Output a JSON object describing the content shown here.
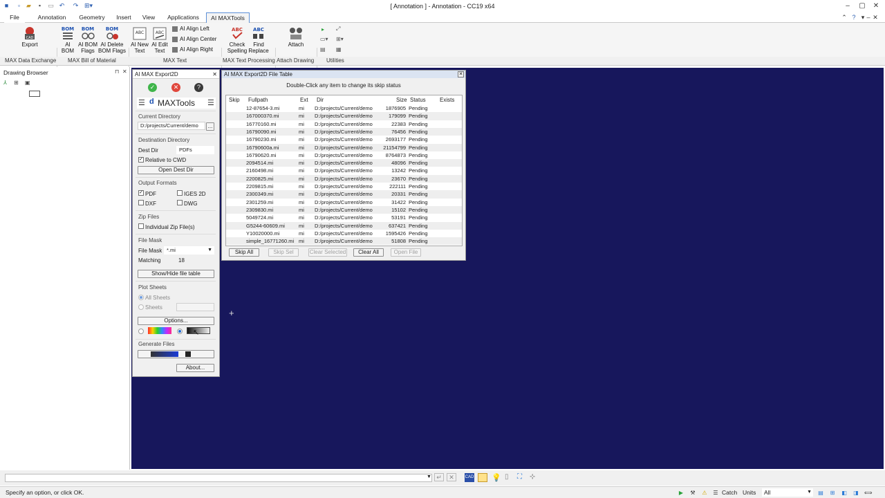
{
  "window": {
    "title": "[ Annotation ] - Annotation - CC19 x64"
  },
  "tabs": [
    "File",
    "Annotation",
    "Geometry",
    "Insert",
    "View",
    "Applications",
    "AI MAXTools"
  ],
  "ribbon": {
    "export": "Export",
    "ai_bom": "AI BOM",
    "ai_bom_line1": "AI",
    "ai_bom_line2": "BOM",
    "ai_bom_flags_line1": "AI BOM",
    "ai_bom_flags_line2": "Flags",
    "ai_delete_line1": "AI Delete",
    "ai_delete_line2": "BOM Flags",
    "ai_new_line1": "AI New",
    "ai_new_line2": "Text",
    "ai_edit_line1": "AI Edit",
    "ai_edit_line2": "Text",
    "align_left": "AI Align Left",
    "align_center": "AI Align Center",
    "align_right": "AI Align Right",
    "check_line1": "Check",
    "check_line2": "Spelling",
    "find_line1": "Find",
    "find_line2": "Replace",
    "attach": "Attach",
    "groups": [
      "MAX Data Exchange",
      "MAX Bill of Material",
      "MAX Text",
      "MAX Text Processing",
      "Attach Drawing",
      "Utilities"
    ]
  },
  "browser": {
    "title": "Drawing Browser"
  },
  "export_panel": {
    "title": "AI MAX Export2D",
    "logo": "MAXTools",
    "current_directory_label": "Current Directory",
    "current_directory_value": "D:/projects/Current/demo",
    "browse": "...",
    "destination_label": "Destination Directory",
    "dest_dir_label": "Dest Dir",
    "dest_dir_value": "PDFs",
    "relative_cwd": "Relative to CWD",
    "open_dest_dir": "Open Dest Dir",
    "output_formats": "Output Formats",
    "pdf": "PDF",
    "iges2d": "IGES 2D",
    "dxf": "DXF",
    "dwg": "DWG",
    "zip_files": "Zip Files",
    "individual_zip": "Individual Zip File(s)",
    "file_mask_section": "File Mask",
    "file_mask_label": "File Mask",
    "file_mask_value": "*.mi",
    "matching_label": "Matching",
    "matching_value": "18",
    "show_hide": "Show/Hide file table",
    "plot_sheets": "Plot Sheets",
    "all_sheets": "All Sheets",
    "sheets": "Sheets",
    "options": "Options...",
    "generate_files": "Generate Files",
    "about": "About..."
  },
  "file_table": {
    "title": "AI MAX Export2D File Table",
    "instruction": "Double-Click any item to change its skip status",
    "columns": [
      "Skip",
      "Fullpath",
      "Ext",
      "Dir",
      "Size",
      "Status",
      "Exists"
    ],
    "rows": [
      {
        "fullpath": "12-87654-3.mi",
        "ext": "mi",
        "dir": "D:/projects/Current/demo",
        "size": "1876905",
        "status": "Pending"
      },
      {
        "fullpath": "167000370.mi",
        "ext": "mi",
        "dir": "D:/projects/Current/demo",
        "size": "179099",
        "status": "Pending"
      },
      {
        "fullpath": "16770160.mi",
        "ext": "mi",
        "dir": "D:/projects/Current/demo",
        "size": "22383",
        "status": "Pending"
      },
      {
        "fullpath": "16790090.mi",
        "ext": "mi",
        "dir": "D:/projects/Current/demo",
        "size": "76456",
        "status": "Pending"
      },
      {
        "fullpath": "16790230.mi",
        "ext": "mi",
        "dir": "D:/projects/Current/demo",
        "size": "2693177",
        "status": "Pending"
      },
      {
        "fullpath": "16790600a.mi",
        "ext": "mi",
        "dir": "D:/projects/Current/demo",
        "size": "21154799",
        "status": "Pending"
      },
      {
        "fullpath": "16790620.mi",
        "ext": "mi",
        "dir": "D:/projects/Current/demo",
        "size": "8764873",
        "status": "Pending"
      },
      {
        "fullpath": "2094514.mi",
        "ext": "mi",
        "dir": "D:/projects/Current/demo",
        "size": "48096",
        "status": "Pending"
      },
      {
        "fullpath": "2160498.mi",
        "ext": "mi",
        "dir": "D:/projects/Current/demo",
        "size": "13242",
        "status": "Pending"
      },
      {
        "fullpath": "2200825.mi",
        "ext": "mi",
        "dir": "D:/projects/Current/demo",
        "size": "23670",
        "status": "Pending"
      },
      {
        "fullpath": "2209815.mi",
        "ext": "mi",
        "dir": "D:/projects/Current/demo",
        "size": "222111",
        "status": "Pending"
      },
      {
        "fullpath": "2300349.mi",
        "ext": "mi",
        "dir": "D:/projects/Current/demo",
        "size": "20331",
        "status": "Pending"
      },
      {
        "fullpath": "2301259.mi",
        "ext": "mi",
        "dir": "D:/projects/Current/demo",
        "size": "31422",
        "status": "Pending"
      },
      {
        "fullpath": "2309830.mi",
        "ext": "mi",
        "dir": "D:/projects/Current/demo",
        "size": "15102",
        "status": "Pending"
      },
      {
        "fullpath": "5049724.mi",
        "ext": "mi",
        "dir": "D:/projects/Current/demo",
        "size": "53191",
        "status": "Pending"
      },
      {
        "fullpath": "G5244-60609.mi",
        "ext": "mi",
        "dir": "D:/projects/Current/demo",
        "size": "637421",
        "status": "Pending"
      },
      {
        "fullpath": "Y10020000.mi",
        "ext": "mi",
        "dir": "D:/projects/Current/demo",
        "size": "1595426",
        "status": "Pending"
      },
      {
        "fullpath": "simple_16771260.mi",
        "ext": "mi",
        "dir": "D:/projects/Current/demo",
        "size": "51808",
        "status": "Pending"
      }
    ],
    "skip_all": "Skip All",
    "skip_sel": "Skip Sel",
    "clear_selected": "Clear Selected",
    "clear_all": "Clear All",
    "open_file": "Open File"
  },
  "status": {
    "prompt": "Specify an option, or click OK.",
    "catch": "Catch",
    "units": "Units",
    "all": "All"
  },
  "colors": {
    "canvas": "#17175c",
    "accent": "#5b8fd6",
    "ok": "#3fb54a",
    "cancel": "#e0473c"
  }
}
